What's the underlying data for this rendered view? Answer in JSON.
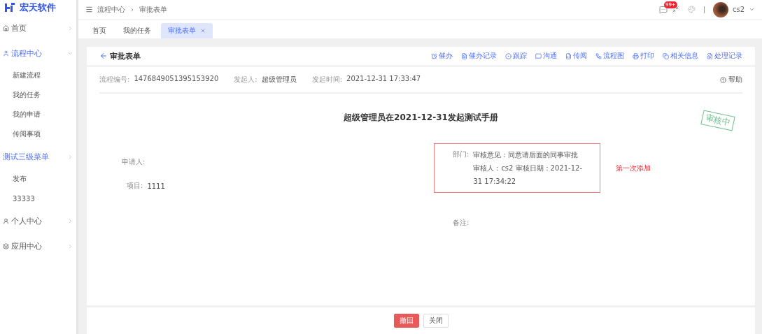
{
  "logo": {
    "text": "宏天软件"
  },
  "sidebar": {
    "items": [
      {
        "label": "首页",
        "highlighted": false,
        "expanded": false
      },
      {
        "label": "流程中心",
        "highlighted": true,
        "expanded": true,
        "children": [
          {
            "label": "新建流程"
          },
          {
            "label": "我的任务"
          },
          {
            "label": "我的申请"
          },
          {
            "label": "传阅事项"
          }
        ]
      },
      {
        "label": "测试三级菜单",
        "highlighted": true,
        "expanded": false,
        "children": [
          {
            "label": "发布"
          },
          {
            "label": "33333"
          }
        ]
      },
      {
        "label": "个人中心",
        "highlighted": false,
        "expanded": false
      },
      {
        "label": "应用中心",
        "highlighted": false,
        "expanded": false
      }
    ]
  },
  "breadcrumb": [
    "流程中心",
    "审批表单"
  ],
  "header": {
    "badge": "99+",
    "user": "cs2"
  },
  "tabs": [
    {
      "label": "首页",
      "selected": false,
      "closable": false
    },
    {
      "label": "我的任务",
      "selected": false,
      "closable": false
    },
    {
      "label": "审批表单",
      "selected": true,
      "closable": true
    }
  ],
  "page": {
    "title": "审批表单",
    "actions": [
      "催办",
      "催办记录",
      "跟踪",
      "沟通",
      "传阅",
      "流程图",
      "打印",
      "相关信息",
      "处理记录"
    ],
    "meta": [
      {
        "label": "流程编号:",
        "value": "1476849051395153920"
      },
      {
        "label": "发起人:",
        "value": "超级管理员"
      },
      {
        "label": "发起时间:",
        "value": "2021-12-31 17:33:47"
      }
    ],
    "help": "帮助",
    "form_title": "超级管理员在2021-12-31发起测试手册",
    "stamp": "审核中",
    "applicant_label": "申请人:",
    "project": {
      "label": "项目:",
      "value": "1111"
    },
    "approval": {
      "label": "部门:",
      "opinion": "审核意见：同意请后面的同事审批",
      "reviewer": "审核人：cs2 审核日期：2021-12-31 17:34:22"
    },
    "note": "第一次添加",
    "remark_label": "备注:"
  },
  "footer": {
    "buttons": [
      {
        "label": "撤回",
        "kind": "primary"
      },
      {
        "label": "关闭",
        "kind": "default"
      }
    ]
  }
}
